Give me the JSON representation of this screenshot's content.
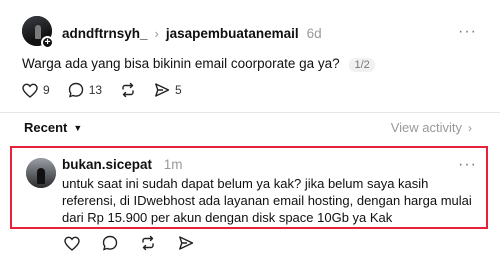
{
  "post": {
    "username": "adndftrnsyh_",
    "community": "jasapembuatanemail",
    "time": "6d",
    "text": "Warga ada yang bisa bikinin email coorporate ga ya?",
    "pager": "1/2",
    "likes": "9",
    "comments": "13",
    "shares": "5",
    "more_label": "···"
  },
  "sort": {
    "label": "Recent",
    "caret": "⌄",
    "view_activity": "View activity",
    "view_arrow": "›"
  },
  "reply": {
    "username": "bukan.sicepat",
    "time": "1m",
    "text": "untuk saat ini sudah dapat belum ya kak? jika belum saya kasih referensi, di IDwebhost ada layanan email hosting, dengan harga mulai dari Rp 15.900 per akun dengan disk space 10Gb ya Kak",
    "more_label": "···"
  },
  "colors": {
    "highlight_border": "#e8213b",
    "muted_text": "#999999",
    "primary_text": "#101010"
  },
  "icons": [
    "heart-icon",
    "comment-icon",
    "repost-icon",
    "share-icon",
    "chevron-right-icon",
    "more-icon",
    "plus-icon"
  ]
}
